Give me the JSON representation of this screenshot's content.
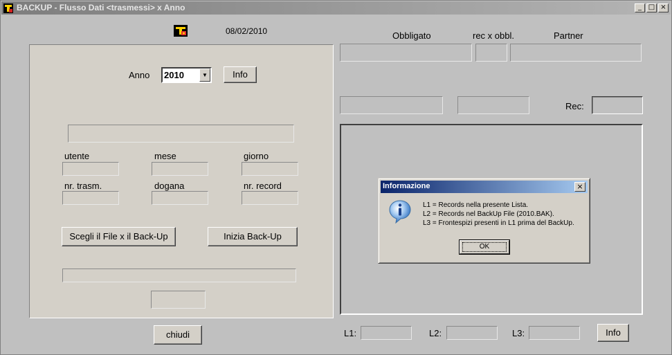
{
  "window": {
    "title": "BACKUP - Flusso Dati <trasmessi> x Anno",
    "controls": {
      "minimize": "_",
      "maximize": "□",
      "close": "×"
    }
  },
  "date": "08/02/2010",
  "left": {
    "anno_label": "Anno",
    "anno_value": "2010",
    "dropdown_arrow": "▼",
    "info_label": "Info",
    "fields": {
      "utente_label": "utente",
      "mese_label": "mese",
      "giorno_label": "giorno",
      "nr_trasm_label": "nr. trasm.",
      "dogana_label": "dogana",
      "nr_record_label": "nr. record"
    },
    "choose_file_label": "Scegli il File x il Back-Up",
    "start_backup_label": "Inizia Back-Up",
    "close_label": "chiudi"
  },
  "right": {
    "headers": {
      "obbligato": "Obbligato",
      "rec_x_obbl": "rec x obbl.",
      "partner": "Partner"
    },
    "rec_label": "Rec:",
    "l1_label": "L1:",
    "l2_label": "L2:",
    "l3_label": "L3:",
    "info_label": "Info"
  },
  "dialog": {
    "title": "Informazione",
    "close": "×",
    "icon": "info-icon",
    "lines": [
      "L1 = Records nella presente Lista.",
      "L2 = Records nel BackUp File (2010.BAK).",
      "L3 = Frontespizi presenti in L1 prima del BackUp."
    ],
    "ok_label": "OK"
  },
  "colors": {
    "window_bg": "#c0c0c0",
    "panel_bg": "#d4d0c8",
    "dialog_title": "#0a246a",
    "info_icon": "#2d6fc0"
  }
}
